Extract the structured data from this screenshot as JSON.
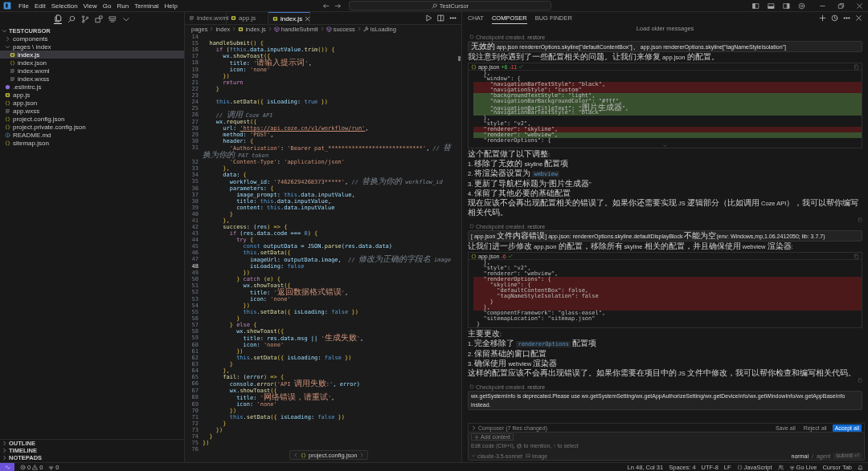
{
  "menu": [
    "File",
    "Edit",
    "Selection",
    "View",
    "Go",
    "Run",
    "Terminal",
    "Help"
  ],
  "command_center": {
    "label": "TestCursor"
  },
  "sidebar": {
    "tree": {
      "label": "TESTCURSOR",
      "expanded": true,
      "children": [
        {
          "label": "components",
          "kind": "folder",
          "expanded": false,
          "selected": false
        },
        {
          "label": "pages \\ index",
          "kind": "folder",
          "expanded": true,
          "selected": false,
          "children": [
            {
              "label": "index.js",
              "kind": "js",
              "selected": true
            },
            {
              "label": "index.json",
              "kind": "json",
              "selected": false
            },
            {
              "label": "index.wxml",
              "kind": "markup",
              "selected": false
            },
            {
              "label": "index.wxss",
              "kind": "markup",
              "selected": false
            }
          ]
        },
        {
          "label": ".eslintrc.js",
          "kind": "eslint",
          "selected": false
        },
        {
          "label": "app.js",
          "kind": "js",
          "selected": false
        },
        {
          "label": "app.json",
          "kind": "json",
          "selected": false
        },
        {
          "label": "app.wxss",
          "kind": "markup",
          "selected": false
        },
        {
          "label": "project.config.json",
          "kind": "json",
          "selected": false
        },
        {
          "label": "project.private.config.json",
          "kind": "json",
          "selected": false
        },
        {
          "label": "README.md",
          "kind": "info",
          "selected": false
        },
        {
          "label": "sitemap.json",
          "kind": "json",
          "selected": false
        }
      ]
    },
    "panels": [
      {
        "label": "OUTLINE",
        "expanded": false
      },
      {
        "label": "TIMELINE",
        "expanded": false
      },
      {
        "label": "NOTEPADS",
        "expanded": false
      }
    ]
  },
  "editor": {
    "tabs": [
      {
        "label": "index.wxml",
        "kind": "markup",
        "selected": false
      },
      {
        "label": "app.js",
        "kind": "js",
        "selected": false
      },
      {
        "label": "index.js",
        "kind": "js",
        "selected": true
      }
    ],
    "breadcrumb": [
      {
        "label": "pages",
        "kind": "folder"
      },
      {
        "label": "index",
        "kind": "folder"
      },
      {
        "label": "index.js",
        "kind": "js"
      },
      {
        "label": "handleSubmit",
        "kind": "method"
      },
      {
        "label": "success",
        "kind": "method"
      },
      {
        "label": "isLoading",
        "kind": "property"
      }
    ],
    "lines": [
      {
        "number": "14",
        "active": false
      },
      {
        "number": "15",
        "active": false,
        "tokens": [
          {
            "text": "  handleSubmit",
            "kind": "func"
          },
          {
            "text": "() {",
            "kind": "punct"
          }
        ]
      },
      {
        "number": "16",
        "active": false,
        "tokens": [
          {
            "text": "    if",
            "kind": "keyword"
          },
          {
            "text": " (!",
            "kind": "plain"
          },
          {
            "text": "this",
            "kind": "this"
          },
          {
            "text": ".data.inputValue.",
            "kind": "prop"
          },
          {
            "text": "trim",
            "kind": "func"
          },
          {
            "text": "()) {",
            "kind": "punct"
          }
        ]
      },
      {
        "number": "17",
        "active": false,
        "tokens": [
          {
            "text": "      wx.",
            "kind": "prop"
          },
          {
            "text": "showToast",
            "kind": "func"
          },
          {
            "text": "({",
            "kind": "punct"
          }
        ]
      },
      {
        "number": "18",
        "active": false,
        "tokens": [
          {
            "text": "        title: ",
            "kind": "prop"
          },
          {
            "text": "'请输入提示词'",
            "kind": "string"
          },
          {
            "text": ",",
            "kind": "plain"
          }
        ]
      },
      {
        "number": "19",
        "active": false,
        "tokens": [
          {
            "text": "        icon: ",
            "kind": "prop"
          },
          {
            "text": "'none'",
            "kind": "string"
          }
        ]
      },
      {
        "number": "20",
        "active": false,
        "tokens": [
          {
            "text": "      })",
            "kind": "punct"
          }
        ]
      },
      {
        "number": "21",
        "active": false,
        "tokens": [
          {
            "text": "      return",
            "kind": "keyword"
          }
        ]
      },
      {
        "number": "22",
        "active": false,
        "tokens": [
          {
            "text": "    }",
            "kind": "punct"
          }
        ]
      },
      {
        "number": "23",
        "active": false
      },
      {
        "number": "24",
        "active": false,
        "tokens": [
          {
            "text": "    this",
            "kind": "this"
          },
          {
            "text": ".",
            "kind": "plain"
          },
          {
            "text": "setData",
            "kind": "func"
          },
          {
            "text": "({ ",
            "kind": "punct"
          },
          {
            "text": "isLoading: ",
            "kind": "prop"
          },
          {
            "text": "true",
            "kind": "literal"
          },
          {
            "text": " })",
            "kind": "punct"
          }
        ]
      },
      {
        "number": "25",
        "active": false
      },
      {
        "number": "26",
        "active": false,
        "tokens": [
          {
            "text": "    // 调用 Coze API",
            "kind": "comment"
          }
        ]
      },
      {
        "number": "27",
        "active": false,
        "tokens": [
          {
            "text": "    wx.",
            "kind": "prop"
          },
          {
            "text": "request",
            "kind": "func"
          },
          {
            "text": "({",
            "kind": "punct"
          }
        ]
      },
      {
        "number": "28",
        "active": false,
        "tokens": [
          {
            "text": "      url: ",
            "kind": "prop"
          },
          {
            "text": "'https://api.coze.cn/v1/workflow/run'",
            "kind": "link"
          },
          {
            "text": ",",
            "kind": "plain"
          }
        ]
      },
      {
        "number": "29",
        "active": false,
        "tokens": [
          {
            "text": "      method: ",
            "kind": "prop"
          },
          {
            "text": "'POST'",
            "kind": "string"
          },
          {
            "text": ",",
            "kind": "plain"
          }
        ]
      },
      {
        "number": "30",
        "active": false,
        "tokens": [
          {
            "text": "      header: ",
            "kind": "prop"
          },
          {
            "text": "{",
            "kind": "punct"
          }
        ]
      },
      {
        "number": "31",
        "active": false,
        "tokens": [
          {
            "text": "        'Authorization'",
            "kind": "string"
          },
          {
            "text": ": ",
            "kind": "plain"
          },
          {
            "text": "'Bearer pat_****************************'",
            "kind": "string"
          },
          {
            "text": ", ",
            "kind": "plain"
          },
          {
            "text": "// 替换为你的 PAT token",
            "kind": "comment"
          }
        ]
      },
      {
        "number": "32",
        "active": false,
        "tokens": [
          {
            "text": "        'Content-Type'",
            "kind": "string"
          },
          {
            "text": ": ",
            "kind": "plain"
          },
          {
            "text": "'application/json'",
            "kind": "string"
          }
        ]
      },
      {
        "number": "33",
        "active": false,
        "tokens": [
          {
            "text": "      },",
            "kind": "punct"
          }
        ]
      },
      {
        "number": "34",
        "active": false,
        "tokens": [
          {
            "text": "      data: ",
            "kind": "prop"
          },
          {
            "text": "{",
            "kind": "punct"
          }
        ]
      },
      {
        "number": "35",
        "active": false,
        "tokens": [
          {
            "text": "        workflow_id: ",
            "kind": "prop"
          },
          {
            "text": "'74626294268373*****'",
            "kind": "string"
          },
          {
            "text": ", ",
            "kind": "plain"
          },
          {
            "text": "// 替换为你的 workflow_id",
            "kind": "comment"
          }
        ]
      },
      {
        "number": "36",
        "active": false,
        "tokens": [
          {
            "text": "        parameters: ",
            "kind": "prop"
          },
          {
            "text": "{",
            "kind": "punct"
          }
        ]
      },
      {
        "number": "37",
        "active": false,
        "tokens": [
          {
            "text": "          image_prompt: ",
            "kind": "prop"
          },
          {
            "text": "this",
            "kind": "this"
          },
          {
            "text": ".data.inputValue,",
            "kind": "prop"
          }
        ]
      },
      {
        "number": "38",
        "active": false,
        "tokens": [
          {
            "text": "          title: ",
            "kind": "prop"
          },
          {
            "text": "this",
            "kind": "this"
          },
          {
            "text": ".data.inputValue,",
            "kind": "prop"
          }
        ]
      },
      {
        "number": "39",
        "active": false,
        "tokens": [
          {
            "text": "          content: ",
            "kind": "prop"
          },
          {
            "text": "this",
            "kind": "this"
          },
          {
            "text": ".data.inputValue",
            "kind": "prop"
          }
        ]
      },
      {
        "number": "40",
        "active": false,
        "tokens": [
          {
            "text": "        }",
            "kind": "punct"
          }
        ]
      },
      {
        "number": "41",
        "active": false,
        "tokens": [
          {
            "text": "      },",
            "kind": "punct"
          }
        ]
      },
      {
        "number": "42",
        "active": false,
        "tokens": [
          {
            "text": "      success",
            "kind": "func"
          },
          {
            "text": ": (",
            "kind": "plain"
          },
          {
            "text": "res",
            "kind": "prop"
          },
          {
            "text": ") => {",
            "kind": "punct"
          }
        ]
      },
      {
        "number": "43",
        "active": false,
        "tokens": [
          {
            "text": "        if",
            "kind": "keyword"
          },
          {
            "text": " (res.data.code === ",
            "kind": "prop"
          },
          {
            "text": "0",
            "kind": "literal"
          },
          {
            "text": ") {",
            "kind": "punct"
          }
        ]
      },
      {
        "number": "44",
        "active": false,
        "tokens": [
          {
            "text": "          try",
            "kind": "keyword"
          },
          {
            "text": " {",
            "kind": "punct"
          }
        ]
      },
      {
        "number": "45",
        "active": false,
        "tokens": [
          {
            "text": "            const",
            "kind": "this"
          },
          {
            "text": " outputData = JSON.",
            "kind": "prop"
          },
          {
            "text": "parse",
            "kind": "func"
          },
          {
            "text": "(res.data.data)",
            "kind": "prop"
          }
        ]
      },
      {
        "number": "46",
        "active": false,
        "tokens": [
          {
            "text": "            this",
            "kind": "this"
          },
          {
            "text": ".",
            "kind": "plain"
          },
          {
            "text": "setData",
            "kind": "func"
          },
          {
            "text": "({",
            "kind": "punct"
          }
        ]
      },
      {
        "number": "47",
        "active": false,
        "tokens": [
          {
            "text": "              imageUrl: outputData.image,  ",
            "kind": "prop"
          },
          {
            "text": "// 修改为正确的字段名 image",
            "kind": "comment"
          }
        ]
      },
      {
        "number": "48",
        "active": true,
        "tokens": [
          {
            "text": "              isLoading: ",
            "kind": "prop"
          },
          {
            "text": "false",
            "kind": "literal"
          }
        ]
      },
      {
        "number": "49",
        "active": false,
        "tokens": [
          {
            "text": "            })",
            "kind": "punct"
          }
        ]
      },
      {
        "number": "50",
        "active": false,
        "tokens": [
          {
            "text": "          } ",
            "kind": "punct"
          },
          {
            "text": "catch",
            "kind": "keyword"
          },
          {
            "text": " (e) {",
            "kind": "punct"
          }
        ]
      },
      {
        "number": "51",
        "active": false,
        "tokens": [
          {
            "text": "            wx.",
            "kind": "prop"
          },
          {
            "text": "showToast",
            "kind": "func"
          },
          {
            "text": "({",
            "kind": "punct"
          }
        ]
      },
      {
        "number": "52",
        "active": false,
        "tokens": [
          {
            "text": "              title: ",
            "kind": "prop"
          },
          {
            "text": "'返回数据格式错误'",
            "kind": "string"
          },
          {
            "text": ",",
            "kind": "plain"
          }
        ]
      },
      {
        "number": "53",
        "active": false,
        "tokens": [
          {
            "text": "              icon: ",
            "kind": "prop"
          },
          {
            "text": "'none'",
            "kind": "string"
          }
        ]
      },
      {
        "number": "54",
        "active": false,
        "tokens": [
          {
            "text": "            })",
            "kind": "punct"
          }
        ]
      },
      {
        "number": "55",
        "active": false,
        "tokens": [
          {
            "text": "            this",
            "kind": "this"
          },
          {
            "text": ".",
            "kind": "plain"
          },
          {
            "text": "setData",
            "kind": "func"
          },
          {
            "text": "({ ",
            "kind": "punct"
          },
          {
            "text": "isLoading: ",
            "kind": "prop"
          },
          {
            "text": "false",
            "kind": "literal"
          },
          {
            "text": " })",
            "kind": "punct"
          }
        ]
      },
      {
        "number": "56",
        "active": false,
        "tokens": [
          {
            "text": "          }",
            "kind": "punct"
          }
        ]
      },
      {
        "number": "57",
        "active": false,
        "tokens": [
          {
            "text": "        } ",
            "kind": "punct"
          },
          {
            "text": "else",
            "kind": "keyword"
          },
          {
            "text": " {",
            "kind": "punct"
          }
        ]
      },
      {
        "number": "58",
        "active": false,
        "tokens": [
          {
            "text": "          wx.",
            "kind": "prop"
          },
          {
            "text": "showToast",
            "kind": "func"
          },
          {
            "text": "({",
            "kind": "punct"
          }
        ]
      },
      {
        "number": "59",
        "active": false,
        "tokens": [
          {
            "text": "            title: res.data.msg || ",
            "kind": "prop"
          },
          {
            "text": "'生成失败'",
            "kind": "string"
          },
          {
            "text": ",",
            "kind": "plain"
          }
        ]
      },
      {
        "number": "60",
        "active": false,
        "tokens": [
          {
            "text": "            icon: ",
            "kind": "prop"
          },
          {
            "text": "'none'",
            "kind": "string"
          }
        ]
      },
      {
        "number": "61",
        "active": false,
        "tokens": [
          {
            "text": "          })",
            "kind": "punct"
          }
        ]
      },
      {
        "number": "62",
        "active": false,
        "tokens": [
          {
            "text": "          this",
            "kind": "this"
          },
          {
            "text": ".",
            "kind": "plain"
          },
          {
            "text": "setData",
            "kind": "func"
          },
          {
            "text": "({ ",
            "kind": "punct"
          },
          {
            "text": "isLoading: ",
            "kind": "prop"
          },
          {
            "text": "false",
            "kind": "literal"
          },
          {
            "text": " })",
            "kind": "punct"
          }
        ]
      },
      {
        "number": "63",
        "active": false,
        "tokens": [
          {
            "text": "        }",
            "kind": "punct"
          }
        ]
      },
      {
        "number": "64",
        "active": false,
        "tokens": [
          {
            "text": "      },",
            "kind": "punct"
          }
        ]
      },
      {
        "number": "65",
        "active": false,
        "tokens": [
          {
            "text": "      fail",
            "kind": "func"
          },
          {
            "text": ": (",
            "kind": "plain"
          },
          {
            "text": "error",
            "kind": "prop"
          },
          {
            "text": ") => {",
            "kind": "punct"
          }
        ]
      },
      {
        "number": "66",
        "active": false,
        "tokens": [
          {
            "text": "        console.",
            "kind": "prop"
          },
          {
            "text": "error",
            "kind": "func"
          },
          {
            "text": "(",
            "kind": "punct"
          },
          {
            "text": "'API 调用失败:'",
            "kind": "string"
          },
          {
            "text": ", error)",
            "kind": "prop"
          }
        ]
      },
      {
        "number": "67",
        "active": false,
        "tokens": [
          {
            "text": "        wx.",
            "kind": "prop"
          },
          {
            "text": "showToast",
            "kind": "func"
          },
          {
            "text": "({",
            "kind": "punct"
          }
        ]
      },
      {
        "number": "68",
        "active": false,
        "tokens": [
          {
            "text": "          title: ",
            "kind": "prop"
          },
          {
            "text": "'网络错误，请重试'",
            "kind": "string"
          },
          {
            "text": ",",
            "kind": "plain"
          }
        ]
      },
      {
        "number": "69",
        "active": false,
        "tokens": [
          {
            "text": "          icon: ",
            "kind": "prop"
          },
          {
            "text": "'none'",
            "kind": "string"
          }
        ]
      },
      {
        "number": "70",
        "active": false,
        "tokens": [
          {
            "text": "        })",
            "kind": "punct"
          }
        ]
      },
      {
        "number": "71",
        "active": false,
        "tokens": [
          {
            "text": "        this",
            "kind": "this"
          },
          {
            "text": ".",
            "kind": "plain"
          },
          {
            "text": "setData",
            "kind": "func"
          },
          {
            "text": "({ ",
            "kind": "punct"
          },
          {
            "text": "isLoading: ",
            "kind": "prop"
          },
          {
            "text": "false",
            "kind": "literal"
          },
          {
            "text": " })",
            "kind": "punct"
          }
        ]
      },
      {
        "number": "72",
        "active": false,
        "tokens": [
          {
            "text": "      }",
            "kind": "punct"
          }
        ]
      },
      {
        "number": "73",
        "active": false,
        "tokens": [
          {
            "text": "    })",
            "kind": "punct"
          }
        ]
      },
      {
        "number": "74",
        "active": false,
        "tokens": [
          {
            "text": "  }",
            "kind": "punct"
          }
        ]
      },
      {
        "number": "75",
        "active": false,
        "tokens": [
          {
            "text": "})",
            "kind": "punct"
          }
        ]
      },
      {
        "number": "76",
        "active": false
      }
    ],
    "peek": {
      "label": "project.config.json",
      "kind": "json"
    }
  },
  "chat": {
    "tabs": [
      {
        "label": "CHAT",
        "selected": false
      },
      {
        "label": "COMPOSER",
        "selected": true
      },
      {
        "label": "BUG FINDER",
        "selected": false
      }
    ],
    "messages": [
      {
        "kind": "load_more",
        "text": "Load older messages"
      },
      {
        "kind": "checkpoint",
        "text": "Checkpoint created.",
        "link": "restore"
      },
      {
        "kind": "user",
        "text": "无效的 app.json rendererOptions.skyline[\"defaultContentBox\"]、app.json rendererOptions.skyline[\"tagNameStyleIsolation\"]"
      },
      {
        "kind": "paragraph",
        "segments": [
          {
            "text": "我注意到你遇到了一些配置相关的问题。让我们来修复 app.json 的配置。",
            "kind": "text"
          }
        ]
      },
      {
        "kind": "code_block",
        "file": "app.json",
        "added": "+6",
        "removed": "-11",
        "applied": true,
        "expandable": true,
        "lines": [
          {
            "text": "  },",
            "kind": "context"
          },
          {
            "text": "  \"window\": {",
            "kind": "context"
          },
          {
            "text": "    \"navigationBarTextStyle\": \"black\",",
            "kind": "removed"
          },
          {
            "text": "    \"navigationStyle\": \"custom\"",
            "kind": "removed"
          },
          {
            "text": "    \"backgroundTextStyle\": \"light\",",
            "kind": "added"
          },
          {
            "text": "    \"navigationBarBackgroundColor\": \"#fff\",",
            "kind": "added"
          },
          {
            "text": "    \"navigationBarTitleText\": \"图片生成器\",",
            "kind": "added"
          },
          {
            "text": "    \"navigationBarTextStyle\": \"black\"",
            "kind": "added"
          },
          {
            "text": "  },",
            "kind": "context"
          },
          {
            "text": "  \"style\": \"v2\",",
            "kind": "context"
          },
          {
            "text": "  \"renderer\": \"skyline\",",
            "kind": "removed"
          },
          {
            "text": "  \"renderer\": \"webview\",",
            "kind": "added"
          },
          {
            "text": "  \"rendererOptions\": {",
            "kind": "context"
          }
        ]
      },
      {
        "kind": "paragraph",
        "segments": [
          {
            "text": "这个配置做了以下调整:",
            "kind": "text"
          }
        ]
      },
      {
        "kind": "list_item",
        "number": "1.",
        "segments": [
          {
            "text": "移除了无效的 skyline 配置项",
            "kind": "text"
          }
        ]
      },
      {
        "kind": "list_item",
        "number": "2.",
        "segments": [
          {
            "text": "将渲染器设置为 ",
            "kind": "text"
          },
          {
            "text": "webview",
            "kind": "code"
          }
        ]
      },
      {
        "kind": "list_item",
        "number": "3.",
        "segments": [
          {
            "text": "更新了导航栏标题为\"图片生成器\"",
            "kind": "text"
          }
        ]
      },
      {
        "kind": "list_item",
        "number": "4.",
        "segments": [
          {
            "text": "保留了其他必要的基础配置",
            "kind": "text"
          }
        ]
      },
      {
        "kind": "paragraph",
        "segments": [
          {
            "text": "现在应该不会再出现配置相关的错误了。如果你还需要实现 JS 逻辑部分（比如调用 Coze API），我可以帮你编写相关代码。",
            "kind": "text"
          }
        ]
      },
      {
        "kind": "actions"
      },
      {
        "kind": "checkpoint",
        "text": "Checkpoint created.",
        "link": "restore"
      },
      {
        "kind": "user",
        "text": "[ app.json 文件内容错误] app.json: rendererOptions.skyline.defaultDisplayBlock 不能为空(env: Windows,mp,1.06.2412050; lib: 3.7.7)"
      },
      {
        "kind": "paragraph",
        "segments": [
          {
            "text": "让我们进一步修改 app.json 的配置，移除所有 skyline 相关的配置，并且确保使用 webview 渲染器:",
            "kind": "text"
          }
        ]
      },
      {
        "kind": "code_block",
        "file": "app.json",
        "removed": "-6",
        "applied": true,
        "expandable": false,
        "lines": [
          {
            "text": "  },",
            "kind": "context"
          },
          {
            "text": "  \"style\": \"v2\",",
            "kind": "context"
          },
          {
            "text": "  \"renderer\": \"webview\",",
            "kind": "context"
          },
          {
            "text": "  \"rendererOptions\": {",
            "kind": "removed"
          },
          {
            "text": "    \"skyline\": {",
            "kind": "removed"
          },
          {
            "text": "      \"defaultContentBox\": false,",
            "kind": "removed"
          },
          {
            "text": "      \"tagNameStyleIsolation\": false",
            "kind": "removed"
          },
          {
            "text": "    }",
            "kind": "removed"
          },
          {
            "text": "  },",
            "kind": "removed"
          },
          {
            "text": "  \"componentFramework\": \"glass-easel\",",
            "kind": "context"
          },
          {
            "text": "  \"sitemapLocation\": \"sitemap.json\"",
            "kind": "context"
          },
          {
            "text": "}",
            "kind": "context"
          }
        ]
      },
      {
        "kind": "paragraph",
        "segments": [
          {
            "text": "主要更改:",
            "kind": "text"
          }
        ]
      },
      {
        "kind": "list_item",
        "number": "1.",
        "segments": [
          {
            "text": "完全移除了 ",
            "kind": "text"
          },
          {
            "text": "rendererOptions",
            "kind": "code"
          },
          {
            "text": " 配置项",
            "kind": "text"
          }
        ]
      },
      {
        "kind": "list_item",
        "number": "2.",
        "segments": [
          {
            "text": "保留基础的窗口配置",
            "kind": "text"
          }
        ]
      },
      {
        "kind": "list_item",
        "number": "3.",
        "segments": [
          {
            "text": "确保使用 webview 渲染器",
            "kind": "text"
          }
        ]
      },
      {
        "kind": "paragraph",
        "segments": [
          {
            "text": "这样的配置应该不会再出现错误了。如果你需要在项目中的 JS 文件中修改，我可以帮你检查和编写相关代码。",
            "kind": "text"
          }
        ]
      },
      {
        "kind": "actions"
      },
      {
        "kind": "checkpoint",
        "text": "Checkpoint created.",
        "link": "restore"
      },
      {
        "kind": "user",
        "text": "wx.getSystemInfo is deprecated.Please use wx.getSystemSetting/wx.getAppAuthorizeSetting/wx.getDeviceInfo/wx.getWindowInfo/wx.getAppBaseInfo instead."
      }
    ],
    "changes": {
      "label": "Composer (7 files changed)",
      "buttons": [
        {
          "label": "Save all",
          "kind": "plain"
        },
        {
          "label": "Reject all",
          "kind": "plain"
        },
        {
          "label": "Accept all",
          "kind": "primary"
        }
      ]
    },
    "input": {
      "context": "Add context",
      "placeholder": "Edit code (Ctrl+I), @ to mention, ↑ to select",
      "model": "claude-3.5-sonnet",
      "attach": "image",
      "modes": [
        {
          "label": "normal",
          "selected": true
        },
        {
          "label": "agent",
          "selected": false
        }
      ],
      "mode_separator": "/",
      "submit": "submit ⏎"
    }
  },
  "status_bar": {
    "errors": "0",
    "warnings": "0",
    "ports": "0",
    "items": [
      {
        "label": "Ln 48, Col 31",
        "kind": "text"
      },
      {
        "label": "Spaces: 4",
        "kind": "text"
      },
      {
        "label": "UTF-8",
        "kind": "text"
      },
      {
        "label": "LF",
        "kind": "text"
      },
      {
        "label": "JavaScript",
        "kind": "language"
      },
      {
        "kind": "feedback"
      },
      {
        "label": "Go Live",
        "kind": "live"
      },
      {
        "label": "Cursor Tab",
        "kind": "text"
      },
      {
        "kind": "notifications"
      }
    ]
  }
}
